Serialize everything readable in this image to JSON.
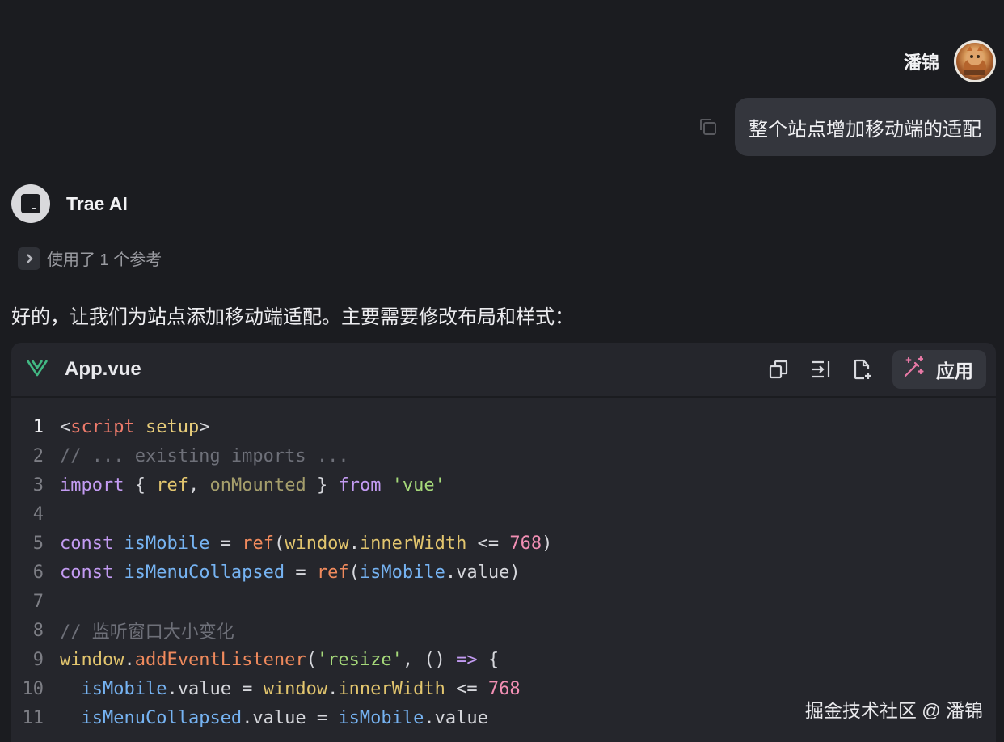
{
  "user": {
    "name": "潘锦",
    "message": "整个站点增加移动端的适配"
  },
  "assistant": {
    "name": "Trae AI",
    "refs_label": "使用了 1 个参考",
    "intro": "好的，让我们为站点添加移动端适配。主要需要修改布局和样式："
  },
  "code_block": {
    "file_name": "App.vue",
    "apply_label": "应用",
    "line_numbers": [
      "1",
      "2",
      "3",
      "4",
      "5",
      "6",
      "7",
      "8",
      "9",
      "10",
      "11"
    ]
  },
  "code_lines": [
    [
      {
        "t": "<",
        "c": "op"
      },
      {
        "t": "script",
        "c": "tag"
      },
      {
        "t": " ",
        "c": "op"
      },
      {
        "t": "setup",
        "c": "attr"
      },
      {
        "t": ">",
        "c": "op"
      }
    ],
    [
      {
        "t": "// ... existing imports ...",
        "c": "cm"
      }
    ],
    [
      {
        "t": "import",
        "c": "kw"
      },
      {
        "t": " { ",
        "c": "op"
      },
      {
        "t": "ref",
        "c": "glob"
      },
      {
        "t": ", ",
        "c": "op"
      },
      {
        "t": "onMounted",
        "c": "dim"
      },
      {
        "t": " } ",
        "c": "op"
      },
      {
        "t": "from",
        "c": "kw"
      },
      {
        "t": " ",
        "c": "op"
      },
      {
        "t": "'vue'",
        "c": "str"
      }
    ],
    [],
    [
      {
        "t": "const",
        "c": "kw"
      },
      {
        "t": " ",
        "c": "op"
      },
      {
        "t": "isMobile",
        "c": "var"
      },
      {
        "t": " = ",
        "c": "op"
      },
      {
        "t": "ref",
        "c": "fn"
      },
      {
        "t": "(",
        "c": "op"
      },
      {
        "t": "window",
        "c": "glob"
      },
      {
        "t": ".",
        "c": "op"
      },
      {
        "t": "innerWidth",
        "c": "glob"
      },
      {
        "t": " <= ",
        "c": "op"
      },
      {
        "t": "768",
        "c": "num"
      },
      {
        "t": ")",
        "c": "op"
      }
    ],
    [
      {
        "t": "const",
        "c": "kw"
      },
      {
        "t": " ",
        "c": "op"
      },
      {
        "t": "isMenuCollapsed",
        "c": "var"
      },
      {
        "t": " = ",
        "c": "op"
      },
      {
        "t": "ref",
        "c": "fn"
      },
      {
        "t": "(",
        "c": "op"
      },
      {
        "t": "isMobile",
        "c": "var"
      },
      {
        "t": ".value)",
        "c": "op"
      }
    ],
    [],
    [
      {
        "t": "// 监听窗口大小变化",
        "c": "cm"
      }
    ],
    [
      {
        "t": "window",
        "c": "glob"
      },
      {
        "t": ".",
        "c": "op"
      },
      {
        "t": "addEventListener",
        "c": "fn"
      },
      {
        "t": "(",
        "c": "op"
      },
      {
        "t": "'resize'",
        "c": "str"
      },
      {
        "t": ", () ",
        "c": "op"
      },
      {
        "t": "=>",
        "c": "arrow"
      },
      {
        "t": " {",
        "c": "op"
      }
    ],
    [
      {
        "t": "  ",
        "c": "op"
      },
      {
        "t": "isMobile",
        "c": "var"
      },
      {
        "t": ".value = ",
        "c": "op"
      },
      {
        "t": "window",
        "c": "glob"
      },
      {
        "t": ".",
        "c": "op"
      },
      {
        "t": "innerWidth",
        "c": "glob"
      },
      {
        "t": " <= ",
        "c": "op"
      },
      {
        "t": "768",
        "c": "num"
      }
    ],
    [
      {
        "t": "  ",
        "c": "op"
      },
      {
        "t": "isMenuCollapsed",
        "c": "var"
      },
      {
        "t": ".value = ",
        "c": "op"
      },
      {
        "t": "isMobile",
        "c": "var"
      },
      {
        "t": ".value",
        "c": "op"
      }
    ]
  ],
  "watermark": "掘金技术社区 @ 潘锦",
  "icons": {
    "file_type": "vue-logo-icon",
    "copy": "copy-icon",
    "insert": "insert-at-cursor-icon",
    "new_file": "new-file-icon",
    "apply": "magic-wand-icon",
    "refs": "chevron-right-icon"
  },
  "colors": {
    "background": "#1b1c20",
    "code_bg": "#25262c",
    "bubble": "#34363d",
    "vue_green": "#42b883",
    "apply_accent": "#e879a6"
  }
}
